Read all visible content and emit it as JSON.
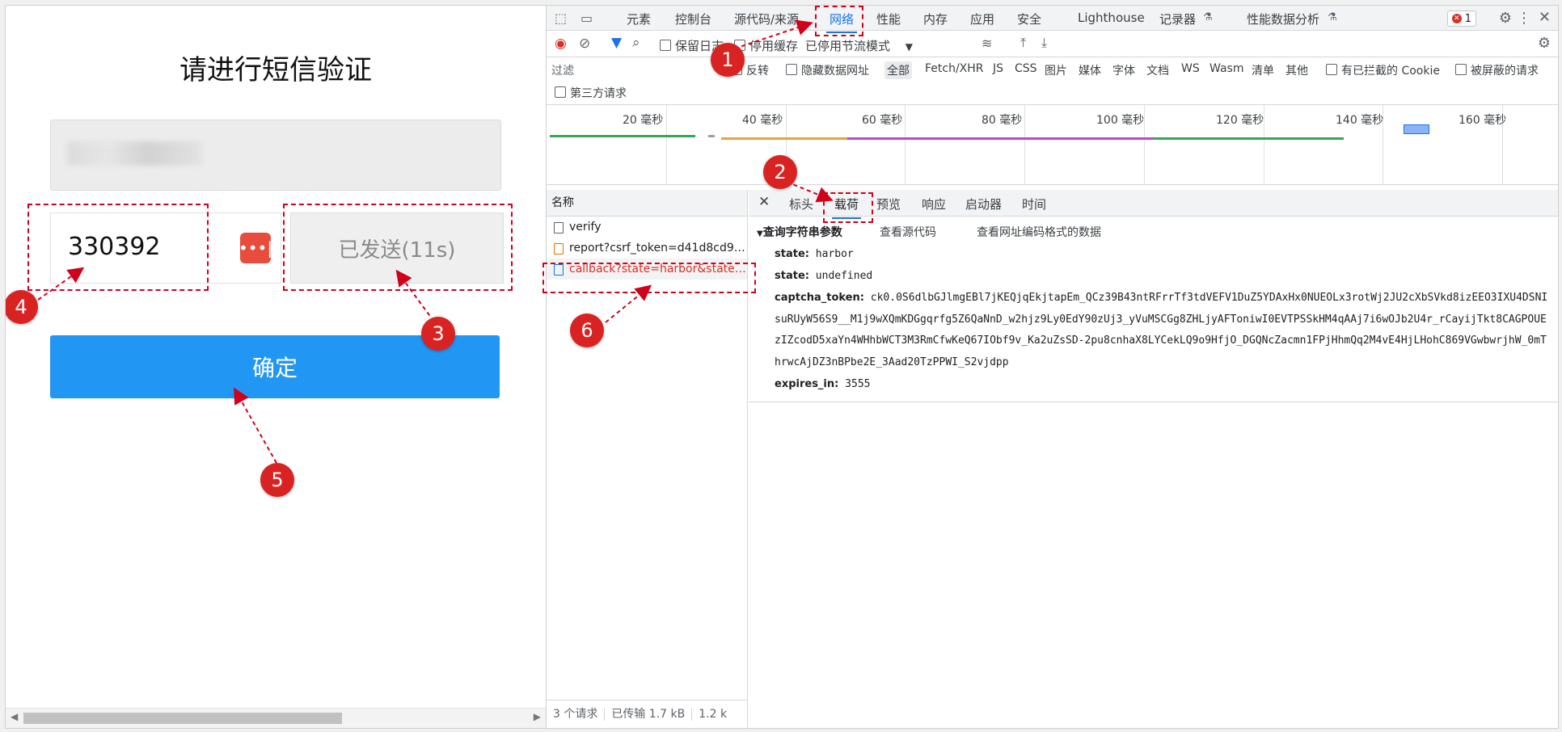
{
  "page": {
    "title": "请进行短信验证",
    "code_value": "330392",
    "send_label": "已发送(11s)",
    "confirm_label": "确定"
  },
  "devtools": {
    "tabs": [
      "元素",
      "控制台",
      "源代码/来源",
      "网络",
      "性能",
      "内存",
      "应用",
      "安全",
      "Lighthouse",
      "记录器",
      "性能数据分析"
    ],
    "active_tab": "网络",
    "error_count": "1",
    "toolbar": {
      "preserve_log": "保留日志",
      "disable_cache": "停用缓存",
      "throttle": "已停用节流模式"
    },
    "filter": {
      "placeholder": "过滤",
      "invert": "反转",
      "hide_data_urls": "隐藏数据网址",
      "types": [
        "全部",
        "Fetch/XHR",
        "JS",
        "CSS",
        "图片",
        "媒体",
        "字体",
        "文档",
        "WS",
        "Wasm",
        "清单",
        "其他"
      ],
      "blocked_cookies": "有已拦截的 Cookie",
      "blocked_requests": "被屏蔽的请求",
      "third_party": "第三方请求"
    },
    "timeline_ticks": [
      "20 毫秒",
      "40 毫秒",
      "60 毫秒",
      "80 毫秒",
      "100 毫秒",
      "120 毫秒",
      "140 毫秒",
      "160 毫秒"
    ],
    "names_header": "名称",
    "requests": [
      {
        "name": "verify"
      },
      {
        "name": "report?csrf_token=d41d8cd98..."
      },
      {
        "name": "callback?state=harbor&state=..."
      }
    ],
    "status": {
      "requests": "3 个请求",
      "transferred": "已传输 1.7 kB",
      "resources": "1.2 k"
    },
    "detail_tabs": [
      "标头",
      "载荷",
      "预览",
      "响应",
      "启动器",
      "时间"
    ],
    "active_detail_tab": "载荷",
    "payload": {
      "section": "查询字符串参数",
      "view_source": "查看源代码",
      "view_url_encoded": "查看网址编码格式的数据",
      "params": [
        {
          "key": "state:",
          "value": "harbor"
        },
        {
          "key": "state:",
          "value": "undefined"
        },
        {
          "key": "captcha_token:",
          "value": "ck0.0S6dlbGJlmgEBl7jKEQjqEkjtapEm_QCz39B43ntRFrrTf3tdVEFV1DuZ5YDAxHx0NUEOLx3rotWj2JU2cXbSVkd8izEEO3IXU4DSNIsuRUyW56S9__M1j9wXQmKDGgqrfg5Z6QaNnD_w2hjz9Ly0EdY90zUj3_yVuMSCGg8ZHLjyAFToniwI0EVTPSSkHM4qAAj7i6wOJb2U4r_rCayijTkt8CAGPOUEzIZcodD5xaYn4WHhbWCT3M3RmCfwKeQ67IObf9v_Ka2uZsSD-2pu8cnhaX8LYCekLQ9o9HfjO_DGQNcZacmn1FPjHhmQq2M4vE4HjLHohC869VGwbwrjhW_0mThrwcAjDZ3nBPbe2E_3Aad20TzPPWI_S2vjdpp"
        },
        {
          "key": "expires_in:",
          "value": "3555"
        }
      ]
    }
  },
  "annotations": [
    "1",
    "2",
    "3",
    "4",
    "5",
    "6"
  ],
  "colors": {
    "accent": "#2196f3",
    "annotation": "#d92323",
    "send_button": "#efefef",
    "key_button": "#e74c3c"
  }
}
